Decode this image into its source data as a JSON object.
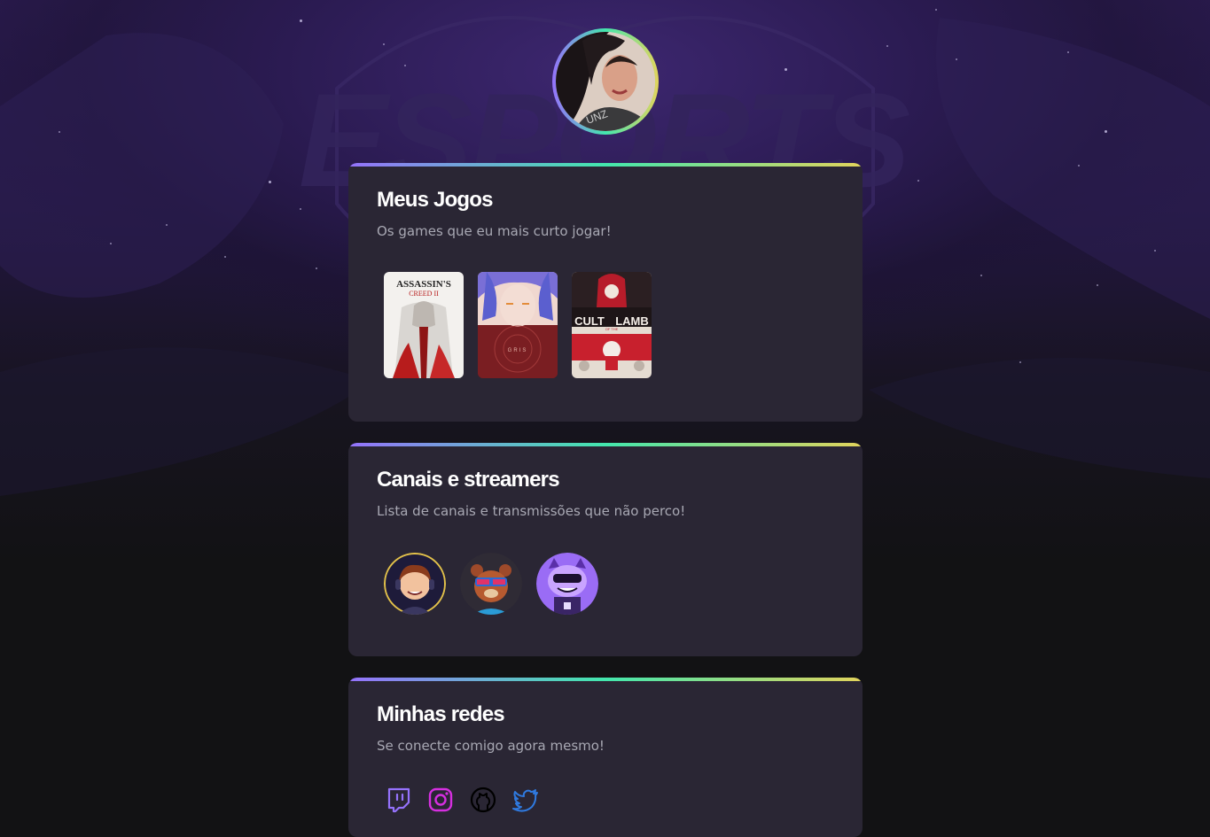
{
  "profile": {
    "avatar_icon": "profile-photo"
  },
  "games_section": {
    "title": "Meus Jogos",
    "subtitle": "Os games que eu mais curto jogar!",
    "games": [
      {
        "name": "Assassin's Creed II",
        "cover_text_1": "ASSASSIN'S",
        "cover_text_2": "CREED II"
      },
      {
        "name": "Gris",
        "cover_text_1": "GRIS"
      },
      {
        "name": "Cult of the Lamb",
        "cover_text_1": "CULT",
        "cover_text_2": "LAMB",
        "cover_text_3": "OF THE"
      }
    ]
  },
  "channels_section": {
    "title": "Canais e streamers",
    "subtitle": "Lista de canais e transmissões que não perco!",
    "channels": [
      {
        "icon": "streamer-avatar-1"
      },
      {
        "icon": "streamer-avatar-2"
      },
      {
        "icon": "streamer-avatar-3"
      }
    ]
  },
  "social_section": {
    "title": "Minhas redes",
    "subtitle": "Se conecte comigo agora mesmo!",
    "links": [
      {
        "icon": "twitch-icon",
        "color": "#9572fc"
      },
      {
        "icon": "instagram-icon",
        "color": "#d62fe0"
      },
      {
        "icon": "github-icon",
        "color": "#000000"
      },
      {
        "icon": "twitter-icon",
        "color": "#2f7ae0"
      }
    ]
  },
  "colors": {
    "gradient_start": "#9572fc",
    "gradient_mid": "#43e7ad",
    "gradient_end": "#e2d45c",
    "card_bg": "#2a2634",
    "text_secondary": "#a8a8b3"
  }
}
